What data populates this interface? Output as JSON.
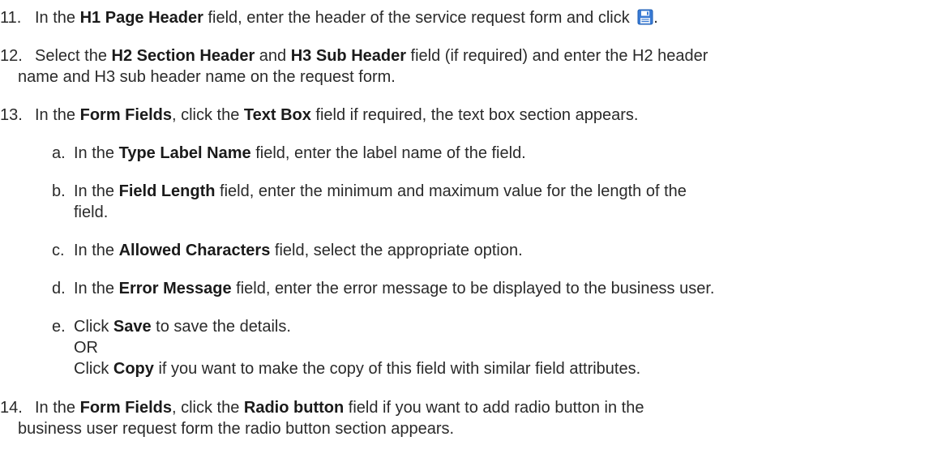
{
  "steps": [
    {
      "num": "11.",
      "parts": [
        {
          "t": "In the ",
          "b": false
        },
        {
          "t": "H1 Page Header",
          "b": true
        },
        {
          "t": " field, enter the header of the service request form and click ",
          "b": false
        }
      ],
      "icon": "save-icon",
      "tail": "."
    },
    {
      "num": "12.",
      "parts": [
        {
          "t": "Select the ",
          "b": false
        },
        {
          "t": "H2 Section Header",
          "b": true
        },
        {
          "t": " and ",
          "b": false
        },
        {
          "t": "H3 Sub Header",
          "b": true
        },
        {
          "t": " field (if required) and enter the H2 header",
          "b": false
        }
      ],
      "cont": "name and H3 sub header name on the request form."
    },
    {
      "num": "13.",
      "parts": [
        {
          "t": "In the ",
          "b": false
        },
        {
          "t": "Form Fields",
          "b": true
        },
        {
          "t": ", click the ",
          "b": false
        },
        {
          "t": "Text Box",
          "b": true
        },
        {
          "t": " field if required, the text box section appears.",
          "b": false
        }
      ]
    },
    {
      "num": "14.",
      "parts": [
        {
          "t": "In the ",
          "b": false
        },
        {
          "t": "Form Fields",
          "b": true
        },
        {
          "t": ", click the ",
          "b": false
        },
        {
          "t": "Radio button",
          "b": true
        },
        {
          "t": " field if you want to add radio button in the",
          "b": false
        }
      ],
      "cont": "business user request form the radio button section appears."
    }
  ],
  "substeps": [
    {
      "letter": "a.",
      "lines": [
        [
          {
            "t": "In the ",
            "b": false
          },
          {
            "t": "Type Label Name",
            "b": true
          },
          {
            "t": " field, enter the label name of the field.",
            "b": false
          }
        ]
      ]
    },
    {
      "letter": "b.",
      "lines": [
        [
          {
            "t": "In the ",
            "b": false
          },
          {
            "t": "Field Length",
            "b": true
          },
          {
            "t": " field, enter the minimum and maximum value for the length of the",
            "b": false
          }
        ],
        [
          {
            "t": "field.",
            "b": false
          }
        ]
      ]
    },
    {
      "letter": "c.",
      "lines": [
        [
          {
            "t": "In the ",
            "b": false
          },
          {
            "t": "Allowed Characters",
            "b": true
          },
          {
            "t": " field, select the appropriate option.",
            "b": false
          }
        ]
      ]
    },
    {
      "letter": "d.",
      "lines": [
        [
          {
            "t": "In the ",
            "b": false
          },
          {
            "t": "Error Message",
            "b": true
          },
          {
            "t": " field, enter the error message to be displayed to the business user.",
            "b": false
          }
        ]
      ]
    },
    {
      "letter": "e.",
      "lines": [
        [
          {
            "t": "Click ",
            "b": false
          },
          {
            "t": "Save",
            "b": true
          },
          {
            "t": " to save the details.",
            "b": false
          }
        ],
        [
          {
            "t": "OR",
            "b": false
          }
        ],
        [
          {
            "t": "Click ",
            "b": false
          },
          {
            "t": "Copy",
            "b": true
          },
          {
            "t": " if you want to make the copy of this field with similar field attributes.",
            "b": false
          }
        ]
      ]
    }
  ]
}
